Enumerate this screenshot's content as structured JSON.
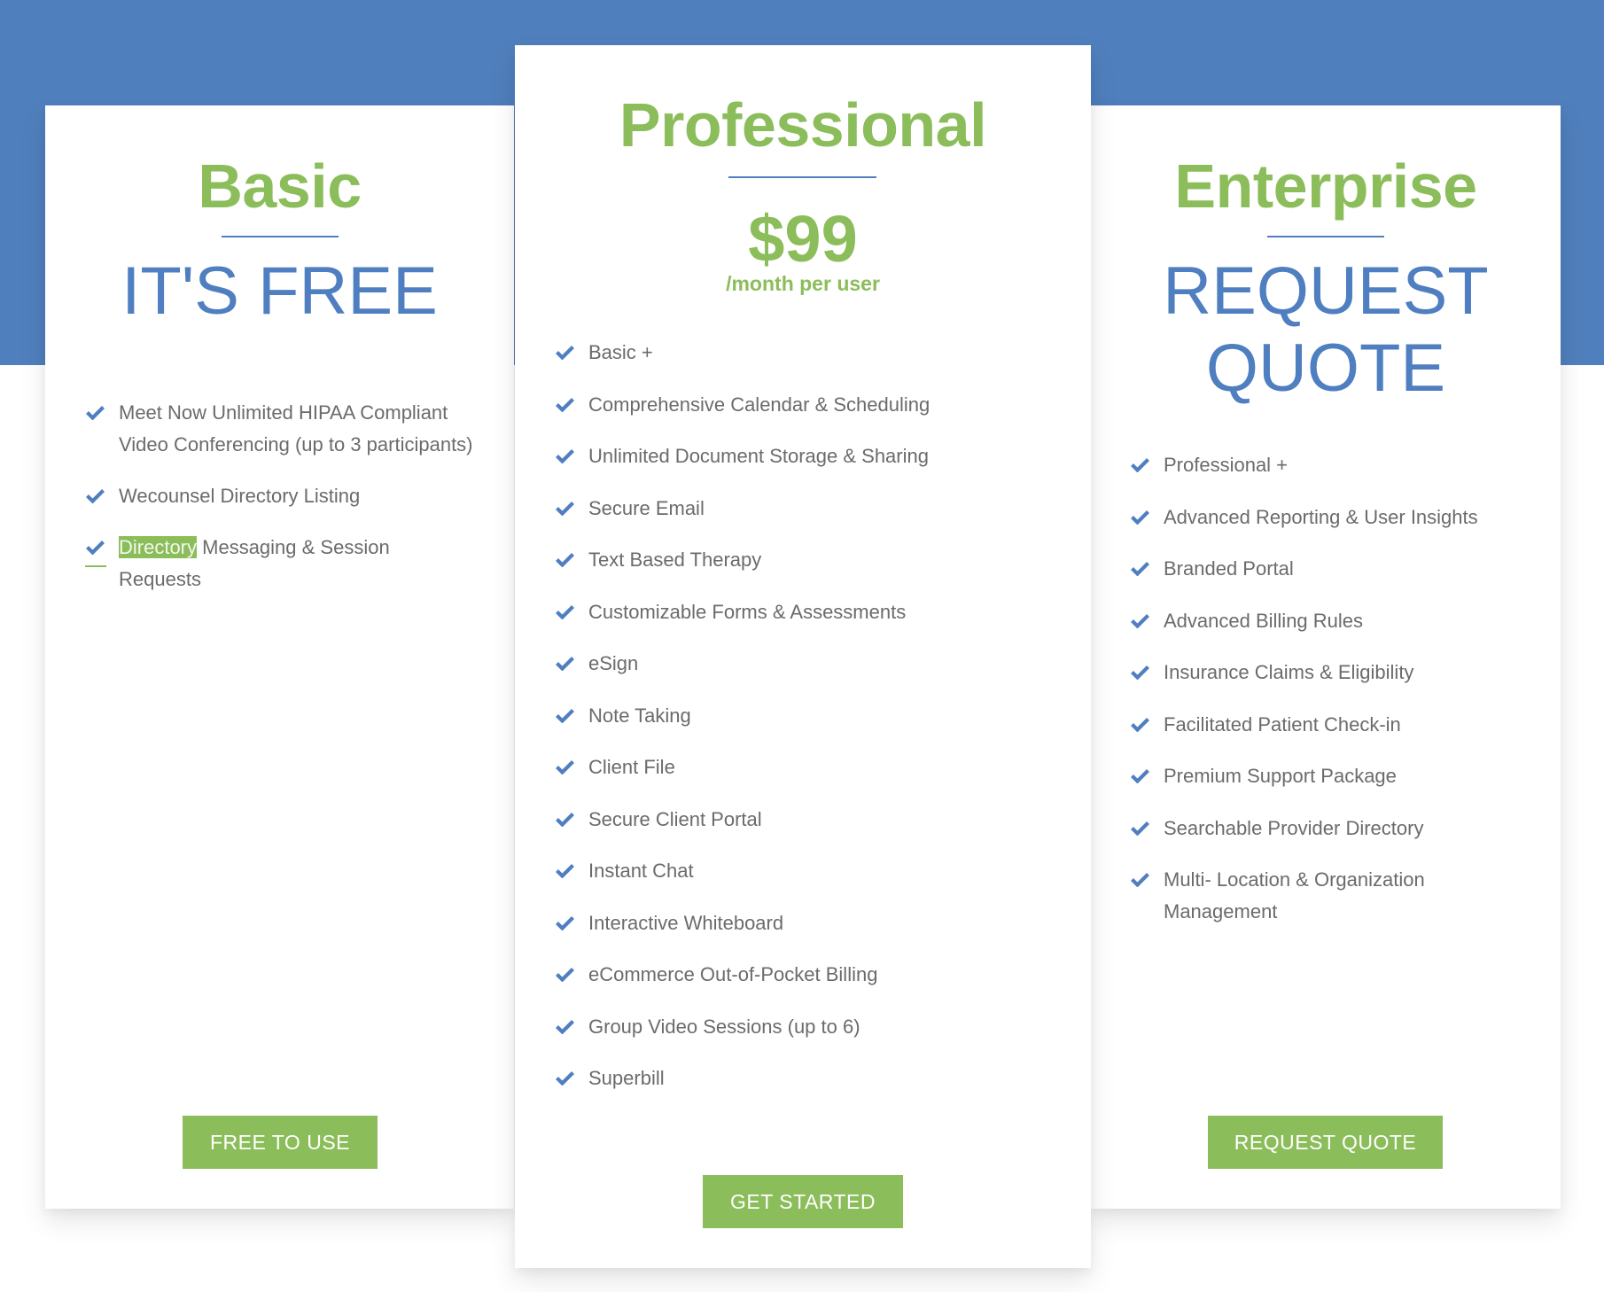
{
  "colors": {
    "band": "#507fbd",
    "accent_green": "#8bbd5a",
    "accent_blue": "#507fbf",
    "feature_text": "#6b6b6b"
  },
  "plans": {
    "basic": {
      "title": "Basic",
      "headline_lines": [
        "IT'S FREE"
      ],
      "features": [
        "Meet Now Unlimited HIPAA Compliant Video Conferencing (up to 3 participants)",
        "Wecounsel Directory Listing",
        {
          "highlighted": "Directory",
          "rest": " Messaging & Session Requests"
        }
      ],
      "cta_label": "FREE TO USE"
    },
    "professional": {
      "title": "Professional",
      "price": "$99",
      "price_period": "/month per user",
      "features": [
        "Basic +",
        "Comprehensive Calendar & Scheduling",
        "Unlimited Document Storage & Sharing",
        "Secure Email",
        "Text Based Therapy",
        "Customizable Forms & Assessments",
        "eSign",
        "Note Taking",
        "Client File",
        "Secure Client Portal",
        "Instant Chat",
        "Interactive Whiteboard",
        "eCommerce Out-of-Pocket Billing",
        "Group Video Sessions (up to 6)",
        "Superbill"
      ],
      "cta_label": "GET STARTED"
    },
    "enterprise": {
      "title": "Enterprise",
      "headline_lines": [
        "REQUEST",
        "QUOTE"
      ],
      "features": [
        "Professional +",
        "Advanced Reporting & User Insights",
        "Branded Portal",
        "Advanced Billing Rules",
        "Insurance Claims & Eligibility",
        "Facilitated Patient Check-in",
        "Premium Support Package",
        "Searchable Provider Directory",
        "Multi- Location & Organization Management"
      ],
      "cta_label": "REQUEST QUOTE"
    }
  },
  "icons": {
    "feature_bullet": "check-icon"
  }
}
